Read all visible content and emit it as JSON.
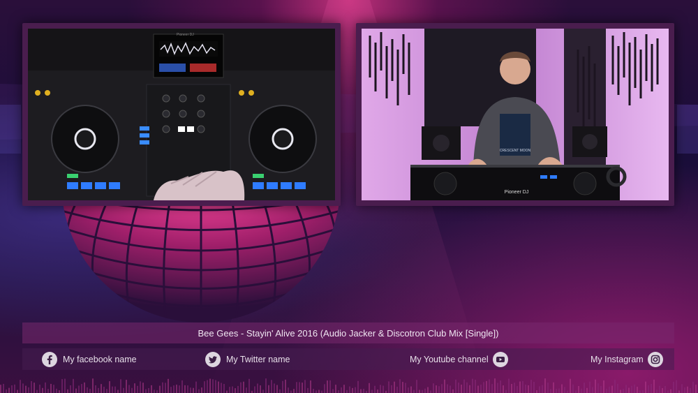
{
  "now_playing": {
    "title": "Bee Gees - Stayin' Alive 2016 (Audio Jacker & Discotron Club Mix [Single])"
  },
  "social": {
    "facebook": "My facebook name",
    "twitter": "My Twitter name",
    "youtube": "My Youtube channel",
    "instagram": "My Instagram"
  },
  "controller_brand": "Pioneer DJ",
  "shirt_text": "CRESCENT MOON",
  "colors": {
    "accent_magenta": "#c0307a",
    "frame": "#4a1d4e",
    "pad_blue": "#2f7cff",
    "jog_ring": "#3fb6ff"
  }
}
